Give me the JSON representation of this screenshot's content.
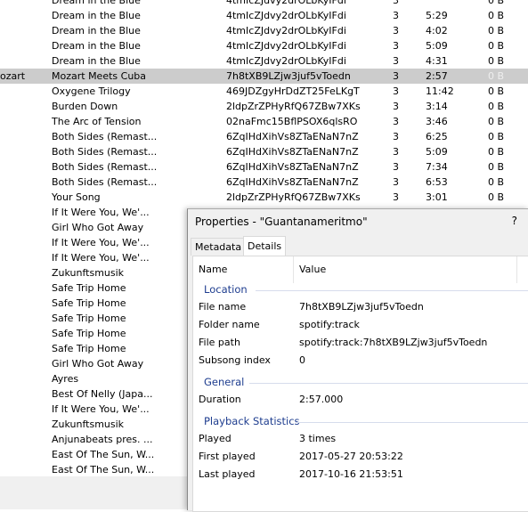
{
  "playlist": {
    "rows": [
      {
        "artist": "",
        "title": "Dream in the Blue",
        "id": "4tmIcZJdvy2drOLbKyIFdi",
        "n": "3",
        "dur": "",
        "size": "0 B"
      },
      {
        "artist": "",
        "title": "Dream in the Blue",
        "id": "4tmIcZJdvy2drOLbKyIFdi",
        "n": "3",
        "dur": "5:29",
        "size": "0 B"
      },
      {
        "artist": "",
        "title": "Dream in the Blue",
        "id": "4tmIcZJdvy2drOLbKyIFdi",
        "n": "3",
        "dur": "4:02",
        "size": "0 B"
      },
      {
        "artist": "",
        "title": "Dream in the Blue",
        "id": "4tmIcZJdvy2drOLbKyIFdi",
        "n": "3",
        "dur": "5:09",
        "size": "0 B"
      },
      {
        "artist": "",
        "title": "Dream in the Blue",
        "id": "4tmIcZJdvy2drOLbKyIFdi",
        "n": "3",
        "dur": "4:31",
        "size": "0 B"
      },
      {
        "artist": "ozart",
        "title": "Mozart Meets Cuba",
        "id": "7h8tXB9LZjw3juf5vToedn",
        "n": "3",
        "dur": "2:57",
        "size": "0 B",
        "selected": true
      },
      {
        "artist": "",
        "title": "Oxygene Trilogy",
        "id": "469JDZgyHrDdZT25FeLKgT",
        "n": "3",
        "dur": "11:42",
        "size": "0 B"
      },
      {
        "artist": "",
        "title": "Burden Down",
        "id": "2ldpZrZPHyRfQ67ZBw7XKs",
        "n": "3",
        "dur": "3:14",
        "size": "0 B"
      },
      {
        "artist": "",
        "title": "The Arc of Tension",
        "id": "02naFmc15BflPSOX6qlsRO",
        "n": "3",
        "dur": "3:46",
        "size": "0 B"
      },
      {
        "artist": "",
        "title": "Both Sides (Remast...",
        "id": "6ZqIHdXihVs8ZTaENaN7nZ",
        "n": "3",
        "dur": "6:25",
        "size": "0 B"
      },
      {
        "artist": "",
        "title": "Both Sides (Remast...",
        "id": "6ZqIHdXihVs8ZTaENaN7nZ",
        "n": "3",
        "dur": "5:09",
        "size": "0 B"
      },
      {
        "artist": "",
        "title": "Both Sides (Remast...",
        "id": "6ZqIHdXihVs8ZTaENaN7nZ",
        "n": "3",
        "dur": "7:34",
        "size": "0 B"
      },
      {
        "artist": "",
        "title": "Both Sides (Remast...",
        "id": "6ZqIHdXihVs8ZTaENaN7nZ",
        "n": "3",
        "dur": "6:53",
        "size": "0 B"
      },
      {
        "artist": "",
        "title": "Your Song",
        "id": "2ldpZrZPHyRfQ67ZBw7XKs",
        "n": "3",
        "dur": "3:01",
        "size": "0 B"
      },
      {
        "artist": "",
        "title": "If It Were You, We'...",
        "id": "",
        "n": "",
        "dur": "",
        "size": ""
      },
      {
        "artist": "",
        "title": "Girl Who Got Away",
        "id": "",
        "n": "",
        "dur": "",
        "size": ""
      },
      {
        "artist": "",
        "title": "If It Were You, We'...",
        "id": "",
        "n": "",
        "dur": "",
        "size": ""
      },
      {
        "artist": "",
        "title": "If It Were You, We'...",
        "id": "",
        "n": "",
        "dur": "",
        "size": ""
      },
      {
        "artist": "",
        "title": "Zukunftsmusik",
        "id": "",
        "n": "",
        "dur": "",
        "size": ""
      },
      {
        "artist": "",
        "title": "Safe Trip Home",
        "id": "",
        "n": "",
        "dur": "",
        "size": ""
      },
      {
        "artist": "",
        "title": "Safe Trip Home",
        "id": "",
        "n": "",
        "dur": "",
        "size": ""
      },
      {
        "artist": "",
        "title": "Safe Trip Home",
        "id": "",
        "n": "",
        "dur": "",
        "size": ""
      },
      {
        "artist": "",
        "title": "Safe Trip Home",
        "id": "",
        "n": "",
        "dur": "",
        "size": ""
      },
      {
        "artist": "",
        "title": "Safe Trip Home",
        "id": "",
        "n": "",
        "dur": "",
        "size": ""
      },
      {
        "artist": "",
        "title": "Girl Who Got Away",
        "id": "",
        "n": "",
        "dur": "",
        "size": ""
      },
      {
        "artist": "",
        "title": "Ayres",
        "id": "",
        "n": "",
        "dur": "",
        "size": ""
      },
      {
        "artist": "",
        "title": "Best Of Nelly (Japa...",
        "id": "",
        "n": "",
        "dur": "",
        "size": ""
      },
      {
        "artist": "",
        "title": "If It Were You, We'...",
        "id": "",
        "n": "",
        "dur": "",
        "size": ""
      },
      {
        "artist": "",
        "title": "Zukunftsmusik",
        "id": "",
        "n": "",
        "dur": "",
        "size": ""
      },
      {
        "artist": "",
        "title": "Anjunabeats pres. ...",
        "id": "",
        "n": "",
        "dur": "",
        "size": ""
      },
      {
        "artist": "",
        "title": "East Of The Sun, W...",
        "id": "",
        "n": "",
        "dur": "",
        "size": ""
      },
      {
        "artist": "",
        "title": "East Of The Sun, W...",
        "id": "",
        "n": "",
        "dur": "",
        "size": ""
      }
    ]
  },
  "dialog": {
    "title": "Properties - \"Guantanameritmo\"",
    "help": "?",
    "tabs": [
      {
        "label": "Metadata",
        "active": false
      },
      {
        "label": "Details",
        "active": true
      }
    ],
    "columns": {
      "name": "Name",
      "value": "Value"
    },
    "groups": [
      {
        "label": "Location",
        "items": [
          {
            "name": "File name",
            "value": "7h8tXB9LZjw3juf5vToedn"
          },
          {
            "name": "Folder name",
            "value": "spotify:track"
          },
          {
            "name": "File path",
            "value": "spotify:track:7h8tXB9LZjw3juf5vToedn"
          },
          {
            "name": "Subsong index",
            "value": "0"
          }
        ]
      },
      {
        "label": "General",
        "items": [
          {
            "name": "Duration",
            "value": "2:57.000"
          }
        ]
      },
      {
        "label": "Playback Statistics",
        "items": [
          {
            "name": "Played",
            "value": "3 times"
          },
          {
            "name": "First played",
            "value": "2017-05-27 20:53:22"
          },
          {
            "name": "Last played",
            "value": "2017-10-16 21:53:51"
          }
        ]
      }
    ]
  }
}
